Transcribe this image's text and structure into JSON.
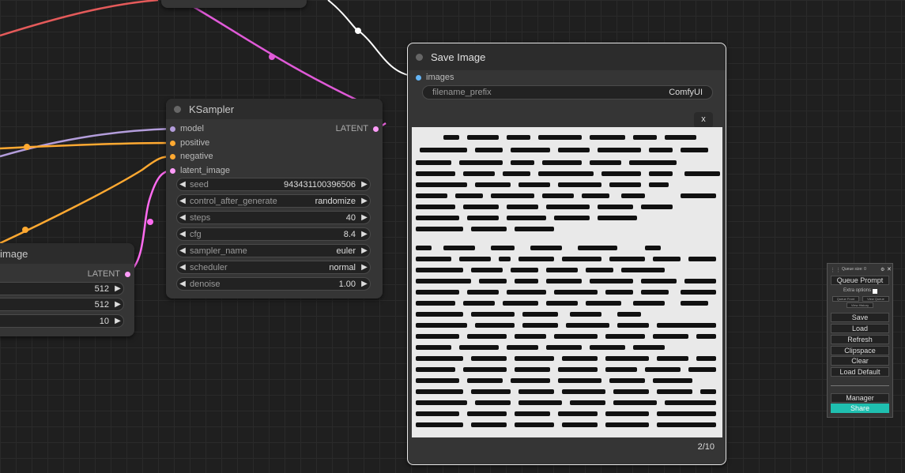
{
  "colors": {
    "background": "#1f1f1f",
    "node_bg": "#353535",
    "model_pin": "#b39ddb",
    "positive_pin": "#ffa931",
    "latent_pin": "#ff9cf9",
    "images_pin": "#64b5f6",
    "share_button": "#1fbfb0"
  },
  "ksampler": {
    "title": "KSampler",
    "inputs": [
      "model",
      "positive",
      "negative",
      "latent_image"
    ],
    "output": "LATENT",
    "widgets": [
      {
        "label": "seed",
        "value": "943431100396506"
      },
      {
        "label": "control_after_generate",
        "value": "randomize"
      },
      {
        "label": "steps",
        "value": "40"
      },
      {
        "label": "cfg",
        "value": "8.4"
      },
      {
        "label": "sampler_name",
        "value": "euler"
      },
      {
        "label": "scheduler",
        "value": "normal"
      },
      {
        "label": "denoise",
        "value": "1.00"
      }
    ]
  },
  "empty_latent": {
    "title": "image",
    "output": "LATENT",
    "widgets": [
      {
        "value": "512"
      },
      {
        "value": "512"
      },
      {
        "value": "10"
      }
    ]
  },
  "save_image": {
    "title": "Save Image",
    "input": "images",
    "filename_label": "filename_prefix",
    "filename_value": "ComfyUI",
    "close_label": "x",
    "counter": "2/10"
  },
  "queue_menu": {
    "queue_size": "Queue size: 0",
    "queue_prompt": "Queue Prompt",
    "extra_options": "Extra options",
    "queue_front": "Queue Front",
    "view_queue": "View Queue",
    "view_history": "View History",
    "save": "Save",
    "load": "Load",
    "refresh": "Refresh",
    "clipspace": "Clipspace",
    "clear": "Clear",
    "load_default": "Load Default",
    "manager": "Manager",
    "share": "Share"
  }
}
